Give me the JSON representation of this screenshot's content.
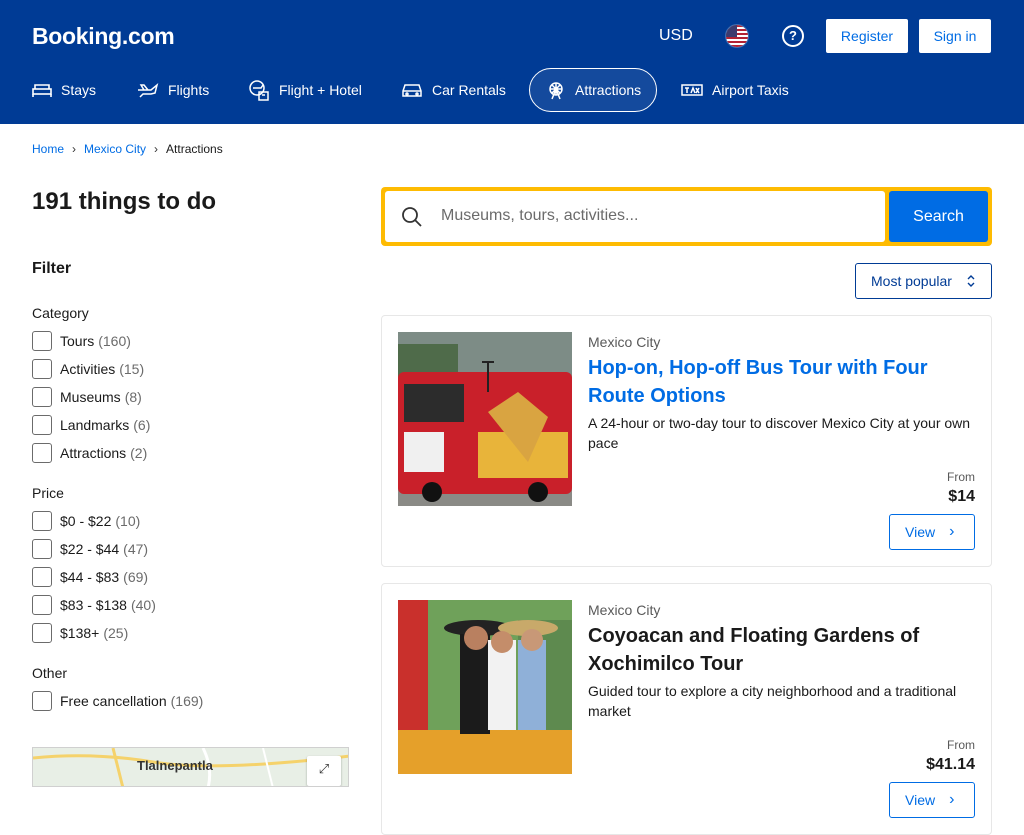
{
  "header": {
    "logo": "Booking.com",
    "currency": "USD",
    "flag_icon": "us-flag-icon",
    "help_icon": "question-circle-icon",
    "register_label": "Register",
    "signin_label": "Sign in",
    "colors": {
      "brand": "#003b95",
      "accent": "#006ce4",
      "search_border": "#febb02"
    }
  },
  "nav": {
    "items": [
      {
        "label": "Stays",
        "icon": "bed-icon"
      },
      {
        "label": "Flights",
        "icon": "airplane-icon"
      },
      {
        "label": "Flight + Hotel",
        "icon": "flight-hotel-icon"
      },
      {
        "label": "Car Rentals",
        "icon": "car-icon"
      },
      {
        "label": "Attractions",
        "icon": "ferris-wheel-icon",
        "active": true
      },
      {
        "label": "Airport Taxis",
        "icon": "taxi-icon"
      }
    ]
  },
  "breadcrumb": {
    "items": [
      "Home",
      "Mexico City",
      "Attractions"
    ]
  },
  "page": {
    "title": "191 things to do"
  },
  "filters": {
    "title": "Filter",
    "groups": [
      {
        "title": "Category",
        "options": [
          {
            "label": "Tours",
            "count": "(160)"
          },
          {
            "label": "Activities",
            "count": "(15)"
          },
          {
            "label": "Museums",
            "count": "(8)"
          },
          {
            "label": "Landmarks",
            "count": "(6)"
          },
          {
            "label": "Attractions",
            "count": "(2)"
          }
        ]
      },
      {
        "title": "Price",
        "options": [
          {
            "label": "$0 - $22",
            "count": "(10)"
          },
          {
            "label": "$22 - $44",
            "count": "(47)"
          },
          {
            "label": "$44 - $83",
            "count": "(69)"
          },
          {
            "label": "$83 - $138",
            "count": "(40)"
          },
          {
            "label": "$138+",
            "count": "(25)"
          }
        ]
      },
      {
        "title": "Other",
        "options": [
          {
            "label": "Free cancellation",
            "count": "(169)"
          }
        ]
      }
    ]
  },
  "map": {
    "place_label": "Tlalnepantla",
    "expand_icon": "expand-icon"
  },
  "search": {
    "placeholder": "Museums, tours, activities...",
    "button_label": "Search",
    "icon": "search-icon"
  },
  "sort": {
    "label": "Most popular",
    "icon": "sort-arrows-icon"
  },
  "results": [
    {
      "location": "Mexico City",
      "title": "Hop-on, Hop-off Bus Tour with Four Route Options",
      "description": "A 24-hour or two-day tour to discover Mexico City at your own pace",
      "from_label": "From",
      "price": "$14",
      "view_label": "View",
      "title_color": "#006ce4"
    },
    {
      "location": "Mexico City",
      "title": "Coyoacan and Floating Gardens of Xochimilco Tour",
      "description": "Guided tour to explore a city neighborhood and a traditional market",
      "from_label": "From",
      "price": "$41.14",
      "view_label": "View",
      "title_color": "#1a1a1a"
    }
  ]
}
